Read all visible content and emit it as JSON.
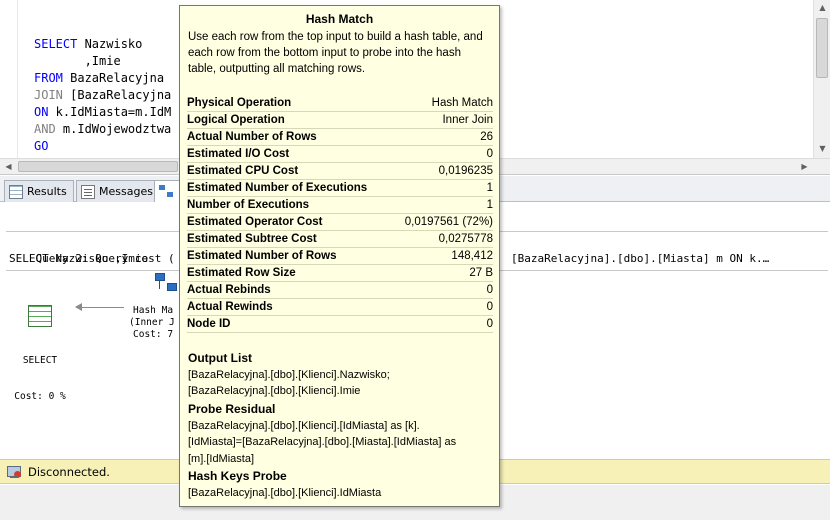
{
  "editor": {
    "code_lines": [
      {
        "kw": "SELECT",
        "rest": " Nazwisko"
      },
      {
        "kw": "",
        "rest": "       ,Imie"
      },
      {
        "kw": "FROM",
        "rest": " BazaRelacyjna"
      },
      {
        "kw": "JOIN",
        "rest": " [BazaRelacyjna"
      },
      {
        "kw": "ON",
        "rest": " k.IdMiasta=m.IdM"
      },
      {
        "kw": "AND",
        "rest": " m.IdWojewodztwa"
      },
      {
        "kw": "GO",
        "rest": ""
      }
    ]
  },
  "tabs": {
    "results_label": "Results",
    "messages_label": "Messages"
  },
  "plan": {
    "query_header": "Query 2: Query cost (",
    "query_sql": "SELECT Nazwisko ,Imie",
    "query_sql_tail": "[BazaRelacyjna].[dbo].[Miasta] m ON k.…",
    "select_node": {
      "name": "SELECT",
      "cost": "Cost: 0 %"
    },
    "hash_node": {
      "name": "Hash Ma",
      "sub": "(Inner J",
      "cost": "Cost: 7"
    }
  },
  "status": {
    "text": "Disconnected."
  },
  "tooltip": {
    "title": "Hash Match",
    "description": "Use each row from the top input to build a hash table, and each row from the bottom input to probe into the hash table, outputting all matching rows.",
    "properties": [
      {
        "name": "Physical Operation",
        "value": "Hash Match"
      },
      {
        "name": "Logical Operation",
        "value": "Inner Join"
      },
      {
        "name": "Actual Number of Rows",
        "value": "26"
      },
      {
        "name": "Estimated I/O Cost",
        "value": "0"
      },
      {
        "name": "Estimated CPU Cost",
        "value": "0,0196235"
      },
      {
        "name": "Estimated Number of Executions",
        "value": "1"
      },
      {
        "name": "Number of Executions",
        "value": "1"
      },
      {
        "name": "Estimated Operator Cost",
        "value": "0,0197561 (72%)"
      },
      {
        "name": "Estimated Subtree Cost",
        "value": "0,0275778"
      },
      {
        "name": "Estimated Number of Rows",
        "value": "148,412"
      },
      {
        "name": "Estimated Row Size",
        "value": "27 B"
      },
      {
        "name": "Actual Rebinds",
        "value": "0"
      },
      {
        "name": "Actual Rewinds",
        "value": "0"
      },
      {
        "name": "Node ID",
        "value": "0"
      }
    ],
    "output_list": {
      "heading": "Output List",
      "lines": [
        "[BazaRelacyjna].[dbo].[Klienci].Nazwisko;",
        "[BazaRelacyjna].[dbo].[Klienci].Imie"
      ]
    },
    "probe_residual": {
      "heading": "Probe Residual",
      "lines": [
        "[BazaRelacyjna].[dbo].[Klienci].[IdMiasta] as [k].",
        "[IdMiasta]=[BazaRelacyjna].[dbo].[Miasta].[IdMiasta] as",
        "[m].[IdMiasta]"
      ]
    },
    "hash_keys_probe": {
      "heading": "Hash Keys Probe",
      "lines": [
        "[BazaRelacyjna].[dbo].[Klienci].IdMiasta"
      ]
    }
  }
}
